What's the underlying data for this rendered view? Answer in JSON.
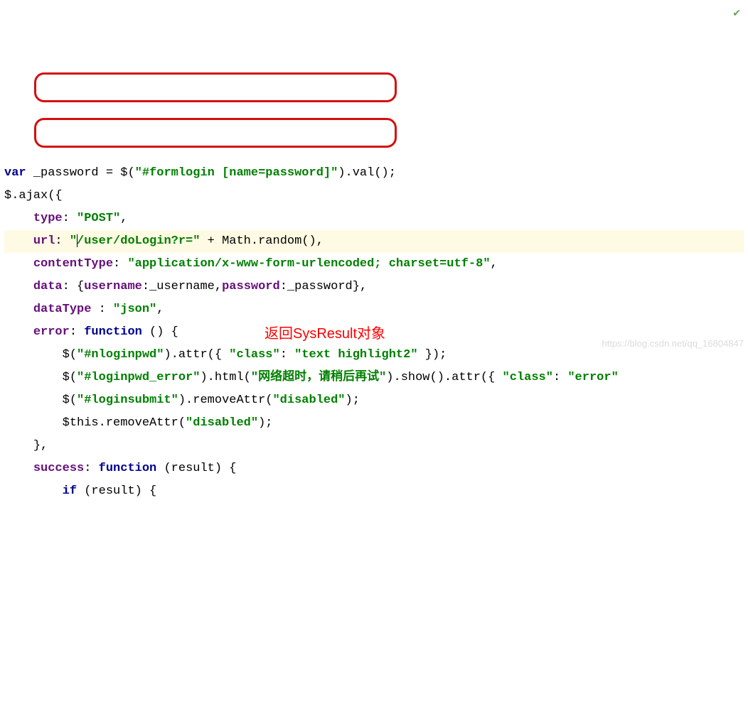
{
  "code": {
    "l1": {
      "var": "var",
      "id": "_password",
      "eq": " = $(",
      "s": "\"#formlogin [name=password]\"",
      "tail": ").val();"
    },
    "l2": {
      "a": "$.ajax({"
    },
    "l3": {
      "k": "type",
      "v": "\"POST\""
    },
    "l4": {
      "k": "url",
      "pre": "\"",
      "mid": "/user/doLogin?r=\"",
      "plus": " + Math.",
      "rand": "random",
      "end": "(),"
    },
    "l5": {
      "k": "contentType",
      "v": "\"application/x-www-form-urlencoded; charset=utf-8\""
    },
    "l6": {
      "k": "data",
      "u": "username",
      "un": "_username",
      "p": "password",
      "pn": "_password"
    },
    "l7": {
      "k": "dataType",
      "v": "\"json\""
    },
    "l8": {
      "k": "error",
      "fn": "function"
    },
    "l9": {
      "s": "\"#nloginpwd\"",
      "cls": "\"class\"",
      "v": "\"text highlight2\""
    },
    "l10": {
      "s": "\"#loginpwd_error\"",
      "msg": "\"网络超时，请稍后再试\"",
      "cls": "\"class\"",
      "v": "\"error\""
    },
    "l11": {
      "s": "\"#loginsubmit\"",
      "d": "\"disabled\""
    },
    "l12": {
      "d": "\"disabled\""
    },
    "l13": {
      "close": "},"
    },
    "l14": {
      "k": "success",
      "fn": "function"
    },
    "l15": {
      "if": "if"
    }
  },
  "annot": {
    "text": "返回SysResult对象"
  },
  "watermark": "https://blog.csdn.net/qq_16804847"
}
